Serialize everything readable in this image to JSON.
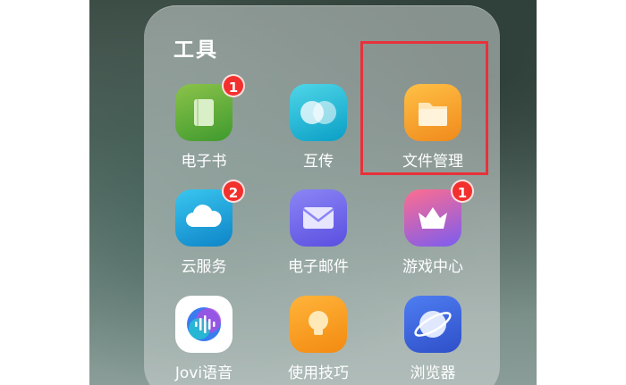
{
  "folder": {
    "title": "工具",
    "apps": [
      {
        "label": "电子书",
        "icon": "ebook-icon",
        "badge": "1"
      },
      {
        "label": "互传",
        "icon": "transfer-icon",
        "badge": ""
      },
      {
        "label": "文件管理",
        "icon": "file-manager-icon",
        "badge": ""
      },
      {
        "label": "云服务",
        "icon": "cloud-service-icon",
        "badge": "2"
      },
      {
        "label": "电子邮件",
        "icon": "email-icon",
        "badge": ""
      },
      {
        "label": "游戏中心",
        "icon": "game-center-icon",
        "badge": "1"
      },
      {
        "label": "Jovi语音",
        "icon": "jovi-voice-icon",
        "badge": ""
      },
      {
        "label": "使用技巧",
        "icon": "tips-icon",
        "badge": ""
      },
      {
        "label": "浏览器",
        "icon": "browser-icon",
        "badge": ""
      }
    ]
  },
  "colors": {
    "badge": "#f2302d",
    "highlight": "#e8313a"
  }
}
